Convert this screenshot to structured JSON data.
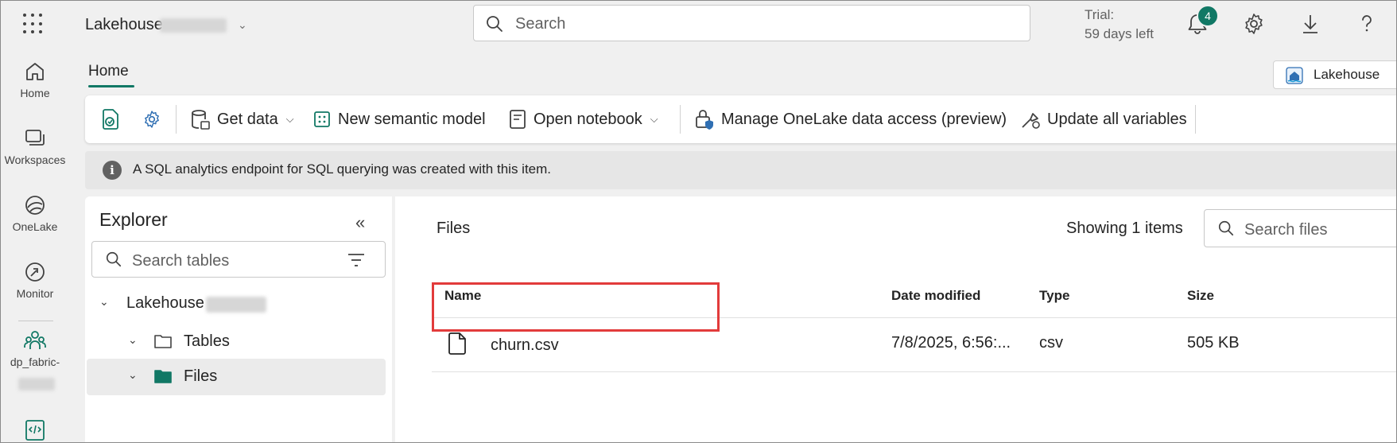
{
  "topbar": {
    "app_name": "Lakehouse",
    "search_placeholder": "Search",
    "trial_line1": "Trial:",
    "trial_line2": "59 days left",
    "notification_count": "4"
  },
  "rail": {
    "items": [
      {
        "label": "Home",
        "icon": "home-icon"
      },
      {
        "label": "Workspaces",
        "icon": "workspaces-icon"
      },
      {
        "label": "OneLake",
        "icon": "onelake-icon"
      },
      {
        "label": "Monitor",
        "icon": "monitor-icon"
      },
      {
        "label": "dp_fabric-",
        "icon": "workspace-group-icon"
      }
    ]
  },
  "tabs": {
    "home": "Home"
  },
  "item_switcher": {
    "label": "Lakehouse"
  },
  "ribbon": {
    "get_data": "Get data",
    "new_semantic_model": "New semantic model",
    "open_notebook": "Open notebook",
    "manage_access": "Manage OneLake data access (preview)",
    "update_variables": "Update all variables"
  },
  "info_bar": {
    "message": "A SQL analytics endpoint for SQL querying was created with this item."
  },
  "explorer": {
    "title": "Explorer",
    "search_placeholder": "Search tables",
    "root": "Lakehouse",
    "tables": "Tables",
    "files": "Files"
  },
  "files_pane": {
    "title": "Files",
    "showing": "Showing 1 items",
    "search_placeholder": "Search files",
    "columns": [
      "Name",
      "Date modified",
      "Type",
      "Size"
    ],
    "rows": [
      {
        "name": "churn.csv",
        "date_modified": "7/8/2025, 6:56:...",
        "type": "csv",
        "size": "505 KB"
      }
    ]
  },
  "colors": {
    "accent": "#117865",
    "highlight_border": "#e23b3b"
  }
}
